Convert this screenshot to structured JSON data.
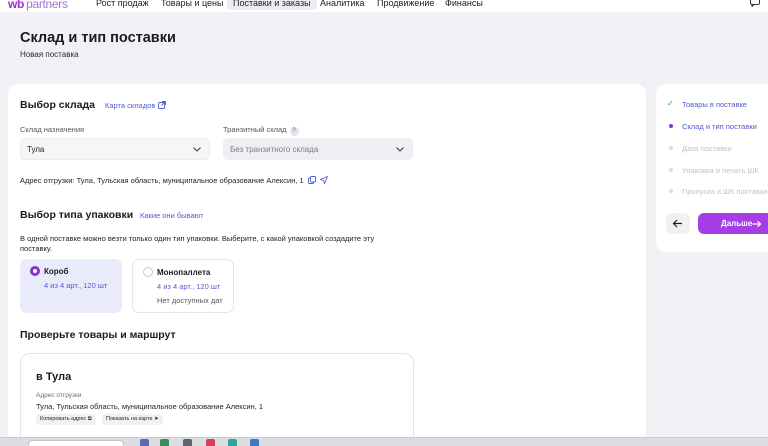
{
  "topbar": {
    "logo_main": "wb",
    "logo_rest": "partners",
    "nav": [
      {
        "label": "Рост продаж",
        "active": false
      },
      {
        "label": "Товары и цены",
        "active": false
      },
      {
        "label": "Поставки и заказы",
        "active": true
      },
      {
        "label": "Аналитика",
        "active": false
      },
      {
        "label": "Продвижение",
        "active": false
      },
      {
        "label": "Финансы",
        "active": false
      }
    ]
  },
  "page": {
    "title": "Склад и тип поставки",
    "subtitle": "Новая поставка"
  },
  "warehouse": {
    "heading": "Выбор склада",
    "map_link": "Карта складов",
    "dest_label": "Склад назначения",
    "dest_value": "Тула",
    "transit_label": "Транзитный склад",
    "transit_help": "?",
    "transit_placeholder": "Без транзитного склада",
    "address_line": "Адрес отгрузки: Тула, Тульская область, муниципальное образование Алексин, 1"
  },
  "packaging": {
    "heading": "Выбор типа упаковки",
    "info_link": "Какие они бывают",
    "description": "В одной поставке можно везти только один тип упаковки. Выберите, с какой упаковкой создадите эту поставку.",
    "options": [
      {
        "title": "Короб",
        "count": "4 из 4 арт., 120 шт",
        "note": "",
        "selected": true
      },
      {
        "title": "Монопаллета",
        "count": "4 из 4 арт., 120 шт",
        "note": "Нет доступных дат",
        "selected": false
      }
    ]
  },
  "route": {
    "heading": "Проверьте товары и маршрут",
    "card_title": "в Тула",
    "address_label": "Адрес отгрузки",
    "address_value": "Тула, Тульская область, муниципальное образование Алексин, 1",
    "copy_chip": "Копировать адрес",
    "map_chip": "Показать на карте"
  },
  "steps": [
    {
      "label": "Товары в поставке",
      "state": "done"
    },
    {
      "label": "Склад и тип поставки",
      "state": "current"
    },
    {
      "label": "Дата поставки",
      "state": "future"
    },
    {
      "label": "Упаковка и печать ШК",
      "state": "future"
    },
    {
      "label": "Пропуска и ШК поставки",
      "state": "future"
    }
  ],
  "actions": {
    "next_label": "Дальше"
  },
  "colors": {
    "accent": "#a63ee8",
    "link": "#4f5bd5",
    "selected_card": "#e9ebfb",
    "background": "#f1f0f5"
  }
}
